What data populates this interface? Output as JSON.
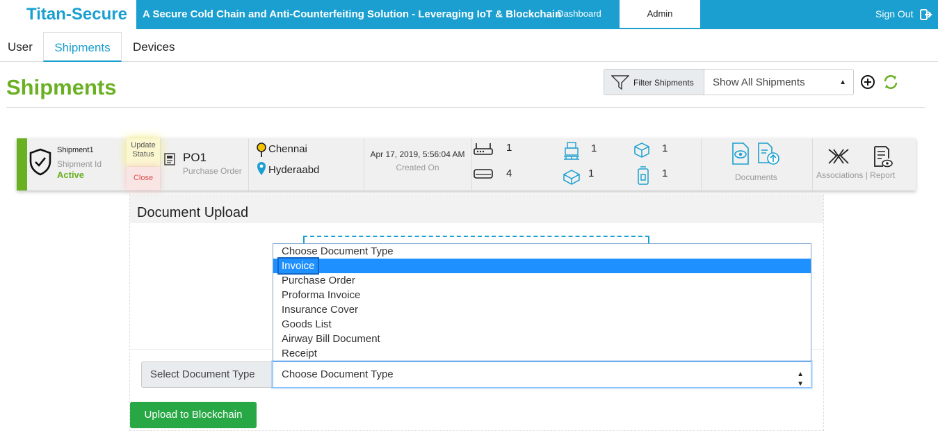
{
  "header": {
    "brand": "Titan-Secure",
    "tagline": "A Secure Cold Chain and Anti-Counterfeiting Solution - Leveraging IoT & Blockchain",
    "nav": {
      "dashboard": "Dashboard",
      "admin": "Admin"
    },
    "signout": "Sign Out"
  },
  "tabs": {
    "user": "User",
    "shipments": "Shipments",
    "devices": "Devices"
  },
  "page": {
    "title": "Shipments",
    "filter_label": "Filter Shipments",
    "filter_value": "Show All Shipments"
  },
  "shipment": {
    "name": "Shipment1",
    "id_label": "Shipment Id",
    "status": "Active",
    "update_status": [
      "Update",
      "Status"
    ],
    "close": "Close",
    "po_value": "PO1",
    "po_label": "Purchase Order",
    "from": "Chennai",
    "to": "Hyderaabd",
    "created_on": "Apr 17, 2019, 5:56:04 AM",
    "created_label": "Created On",
    "devices": {
      "gateway": "1",
      "sensor": "4",
      "pallet": "1",
      "carton": "1",
      "package": "1",
      "product": "1"
    },
    "documents_label": "Documents",
    "associations_label": "Associations | Report"
  },
  "upload": {
    "title": "Document Upload",
    "dropdown_options": [
      "Choose Document Type",
      "Invoice",
      "Purchase Order",
      "Proforma Invoice",
      "Insurance Cover",
      "Goods List",
      "Airway Bill Document",
      "Receipt"
    ],
    "selected_option": "Invoice",
    "select_label": "Select Document Type",
    "select_value": "Choose Document Type",
    "button": "Upload to Blockchain"
  },
  "colors": {
    "brand_blue": "#1a9fd0",
    "accent_green": "#6ab023",
    "button_green": "#28a745",
    "highlight_blue": "#1e90ff"
  }
}
